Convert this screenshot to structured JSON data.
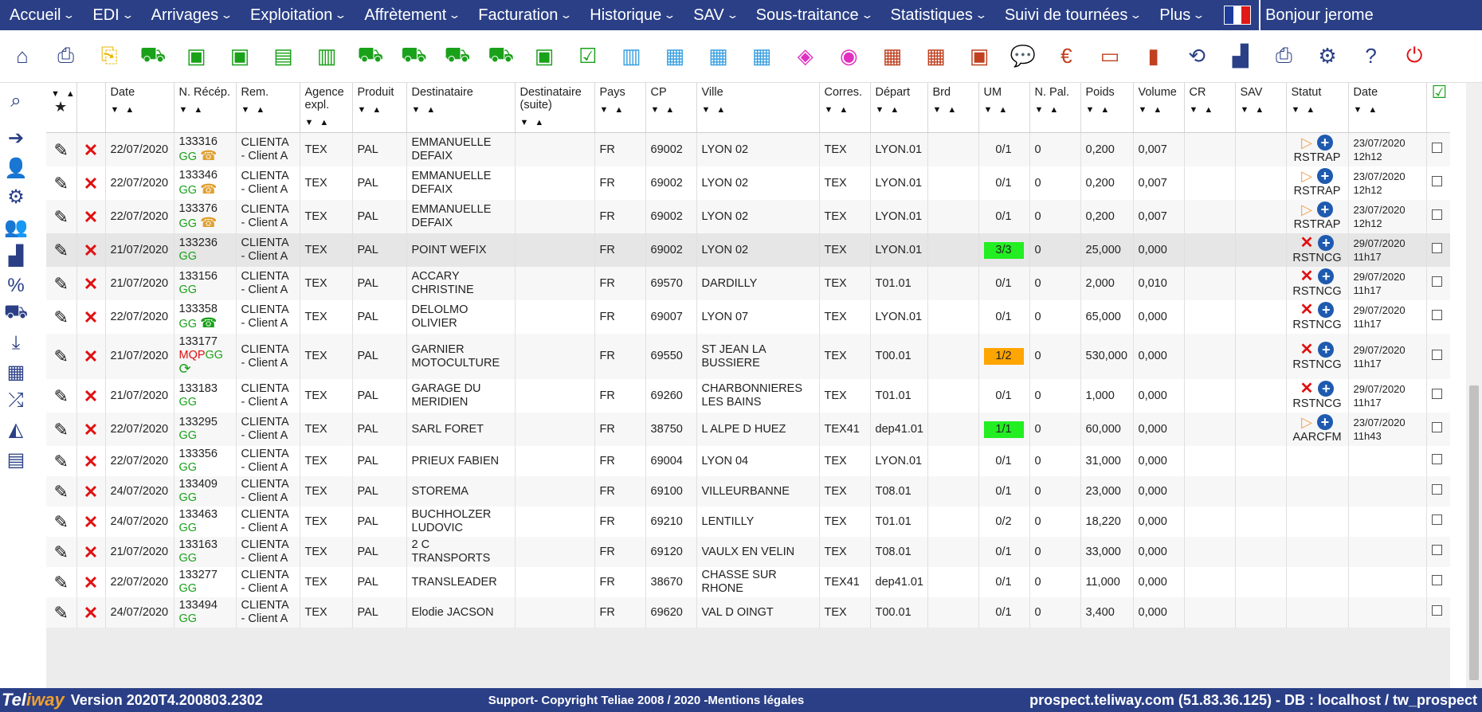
{
  "nav": {
    "items": [
      "Accueil",
      "EDI",
      "Arrivages",
      "Exploitation",
      "Affrètement",
      "Facturation",
      "Historique",
      "SAV",
      "Sous-traitance",
      "Statistiques",
      "Suivi de tournées",
      "Plus"
    ],
    "greeting": "Bonjour jerome"
  },
  "colors": {
    "navy": "#2a3f86",
    "accent_green": "#1aa11a",
    "delete_red": "#e01010"
  },
  "toolbar_icons": [
    "home-icon",
    "printer-icon",
    "edi-file-icon",
    "truck-icon",
    "box-x-icon",
    "box-plus-icon",
    "boxes-icon",
    "barcode-icon",
    "trucks-icon",
    "trucks-grid-icon",
    "trucks-swap-icon",
    "truck-fast-icon",
    "box-info-icon",
    "checkbox-icon",
    "barcode-info-icon",
    "cubes-icon",
    "cubes-swap-icon",
    "calendar-info-icon",
    "database-icon",
    "coins-icon",
    "calendar-icon",
    "calendar-edit-icon",
    "box-question-icon",
    "chat-icon",
    "euro-icon",
    "monitor-arrow-icon",
    "book-icon",
    "history-icon",
    "chart-icon",
    "print-icon",
    "gear-icon",
    "help-icon",
    "power-icon"
  ],
  "sidebar_icons": [
    "search-icon",
    "arrow-right-circle-icon",
    "user-icon",
    "gears-icon",
    "users-icon",
    "factory-icon",
    "percent-icon",
    "truck-icon",
    "download-icon",
    "table-icon",
    "shuffle-icon",
    "area-chart-icon",
    "document-icon"
  ],
  "columns": [
    "Date",
    "N. Récép.",
    "Rem.",
    "Agence expl.",
    "Produit",
    "Destinataire",
    "Destinataire (suite)",
    "Pays",
    "CP",
    "Ville",
    "Corres.",
    "Départ",
    "Brd",
    "UM",
    "N. Pal.",
    "Poids",
    "Volume",
    "CR",
    "SAV",
    "Statut",
    "Date"
  ],
  "rows": [
    {
      "date": "22/07/2020",
      "recep": "133316",
      "tags": "GG",
      "phone": "orange",
      "rem": "CLIENTA - Client A",
      "agence": "TEX",
      "produit": "PAL",
      "dest": "EMMANUELLE DEFAIX",
      "pays": "FR",
      "cp": "69002",
      "ville": "LYON 02",
      "corres": "TEX",
      "depart": "LYON.01",
      "um": "0/1",
      "um_style": "none",
      "npal": "0",
      "poids": "0,200",
      "volume": "0,007",
      "statut_icon": "play",
      "statut": "RSTRAP",
      "date2": "23/07/2020 12h12"
    },
    {
      "date": "22/07/2020",
      "recep": "133346",
      "tags": "GG",
      "phone": "orange",
      "rem": "CLIENTA - Client A",
      "agence": "TEX",
      "produit": "PAL",
      "dest": "EMMANUELLE DEFAIX",
      "pays": "FR",
      "cp": "69002",
      "ville": "LYON 02",
      "corres": "TEX",
      "depart": "LYON.01",
      "um": "0/1",
      "um_style": "none",
      "npal": "0",
      "poids": "0,200",
      "volume": "0,007",
      "statut_icon": "play",
      "statut": "RSTRAP",
      "date2": "23/07/2020 12h12"
    },
    {
      "date": "22/07/2020",
      "recep": "133376",
      "tags": "GG",
      "phone": "orange",
      "rem": "CLIENTA - Client A",
      "agence": "TEX",
      "produit": "PAL",
      "dest": "EMMANUELLE DEFAIX",
      "pays": "FR",
      "cp": "69002",
      "ville": "LYON 02",
      "corres": "TEX",
      "depart": "LYON.01",
      "um": "0/1",
      "um_style": "none",
      "npal": "0",
      "poids": "0,200",
      "volume": "0,007",
      "statut_icon": "play",
      "statut": "RSTRAP",
      "date2": "23/07/2020 12h12"
    },
    {
      "date": "21/07/2020",
      "recep": "133236",
      "tags": "GG",
      "phone": "",
      "rem": "CLIENTA - Client A",
      "agence": "TEX",
      "produit": "PAL",
      "dest": "POINT WEFIX",
      "pays": "FR",
      "cp": "69002",
      "ville": "LYON 02",
      "corres": "TEX",
      "depart": "LYON.01",
      "um": "3/3",
      "um_style": "green",
      "npal": "0",
      "poids": "25,000",
      "volume": "0,000",
      "statut_icon": "x",
      "statut": "RSTNCG",
      "date2": "29/07/2020 11h17",
      "hl": true
    },
    {
      "date": "21/07/2020",
      "recep": "133156",
      "tags": "GG",
      "phone": "",
      "rem": "CLIENTA - Client A",
      "agence": "TEX",
      "produit": "PAL",
      "dest": "ACCARY CHRISTINE",
      "pays": "FR",
      "cp": "69570",
      "ville": "DARDILLY",
      "corres": "TEX",
      "depart": "T01.01",
      "um": "0/1",
      "um_style": "none",
      "npal": "0",
      "poids": "2,000",
      "volume": "0,010",
      "statut_icon": "x",
      "statut": "RSTNCG",
      "date2": "29/07/2020 11h17"
    },
    {
      "date": "22/07/2020",
      "recep": "133358",
      "tags": "GG",
      "phone": "green",
      "rem": "CLIENTA - Client A",
      "agence": "TEX",
      "produit": "PAL",
      "dest": "DELOLMO OLIVIER",
      "pays": "FR",
      "cp": "69007",
      "ville": "LYON 07",
      "corres": "TEX",
      "depart": "LYON.01",
      "um": "0/1",
      "um_style": "none",
      "npal": "0",
      "poids": "65,000",
      "volume": "0,000",
      "statut_icon": "x",
      "statut": "RSTNCG",
      "date2": "29/07/2020 11h17"
    },
    {
      "date": "21/07/2020",
      "recep": "133177",
      "tags": "MQPGG",
      "phone": "",
      "rem": "CLIENTA - Client A",
      "agence": "TEX",
      "produit": "PAL",
      "dest": "GARNIER MOTOCULTURE",
      "pays": "FR",
      "cp": "69550",
      "ville": "ST JEAN LA BUSSIERE",
      "corres": "TEX",
      "depart": "T00.01",
      "um": "1/2",
      "um_style": "orange",
      "npal": "0",
      "poids": "530,000",
      "volume": "0,000",
      "statut_icon": "x",
      "statut": "RSTNCG",
      "date2": "29/07/2020 11h17",
      "swap": true
    },
    {
      "date": "21/07/2020",
      "recep": "133183",
      "tags": "GG",
      "phone": "",
      "rem": "CLIENTA - Client A",
      "agence": "TEX",
      "produit": "PAL",
      "dest": "GARAGE DU MERIDIEN",
      "pays": "FR",
      "cp": "69260",
      "ville": "CHARBONNIERES LES BAINS",
      "corres": "TEX",
      "depart": "T01.01",
      "um": "0/1",
      "um_style": "none",
      "npal": "0",
      "poids": "1,000",
      "volume": "0,000",
      "statut_icon": "x",
      "statut": "RSTNCG",
      "date2": "29/07/2020 11h17"
    },
    {
      "date": "22/07/2020",
      "recep": "133295",
      "tags": "GG",
      "phone": "",
      "rem": "CLIENTA - Client A",
      "agence": "TEX",
      "produit": "PAL",
      "dest": "SARL FORET",
      "pays": "FR",
      "cp": "38750",
      "ville": "L ALPE D HUEZ",
      "corres": "TEX41",
      "depart": "dep41.01",
      "um": "1/1",
      "um_style": "green",
      "npal": "0",
      "poids": "60,000",
      "volume": "0,000",
      "statut_icon": "play",
      "statut": "AARCFM",
      "date2": "23/07/2020 11h43"
    },
    {
      "date": "22/07/2020",
      "recep": "133356",
      "tags": "GG",
      "phone": "",
      "rem": "CLIENTA - Client A",
      "agence": "TEX",
      "produit": "PAL",
      "dest": "PRIEUX FABIEN",
      "pays": "FR",
      "cp": "69004",
      "ville": "LYON 04",
      "corres": "TEX",
      "depart": "LYON.01",
      "um": "0/1",
      "um_style": "none",
      "npal": "0",
      "poids": "31,000",
      "volume": "0,000",
      "statut_icon": "",
      "statut": "",
      "date2": ""
    },
    {
      "date": "24/07/2020",
      "recep": "133409",
      "tags": "GG",
      "phone": "",
      "rem": "CLIENTA - Client A",
      "agence": "TEX",
      "produit": "PAL",
      "dest": "STOREMA",
      "pays": "FR",
      "cp": "69100",
      "ville": "VILLEURBANNE",
      "corres": "TEX",
      "depart": "T08.01",
      "um": "0/1",
      "um_style": "none",
      "npal": "0",
      "poids": "23,000",
      "volume": "0,000",
      "statut_icon": "",
      "statut": "",
      "date2": ""
    },
    {
      "date": "24/07/2020",
      "recep": "133463",
      "tags": "GG",
      "phone": "",
      "rem": "CLIENTA - Client A",
      "agence": "TEX",
      "produit": "PAL",
      "dest": "BUCHHOLZER LUDOVIC",
      "pays": "FR",
      "cp": "69210",
      "ville": "LENTILLY",
      "corres": "TEX",
      "depart": "T01.01",
      "um": "0/2",
      "um_style": "none",
      "npal": "0",
      "poids": "18,220",
      "volume": "0,000",
      "statut_icon": "",
      "statut": "",
      "date2": ""
    },
    {
      "date": "21/07/2020",
      "recep": "133163",
      "tags": "GG",
      "phone": "",
      "rem": "CLIENTA - Client A",
      "agence": "TEX",
      "produit": "PAL",
      "dest": "2 C TRANSPORTS",
      "pays": "FR",
      "cp": "69120",
      "ville": "VAULX EN VELIN",
      "corres": "TEX",
      "depart": "T08.01",
      "um": "0/1",
      "um_style": "none",
      "npal": "0",
      "poids": "33,000",
      "volume": "0,000",
      "statut_icon": "",
      "statut": "",
      "date2": ""
    },
    {
      "date": "22/07/2020",
      "recep": "133277",
      "tags": "GG",
      "phone": "",
      "rem": "CLIENTA - Client A",
      "agence": "TEX",
      "produit": "PAL",
      "dest": "TRANSLEADER",
      "pays": "FR",
      "cp": "38670",
      "ville": "CHASSE SUR RHONE",
      "corres": "TEX41",
      "depart": "dep41.01",
      "um": "0/1",
      "um_style": "none",
      "npal": "0",
      "poids": "11,000",
      "volume": "0,000",
      "statut_icon": "",
      "statut": "",
      "date2": ""
    },
    {
      "date": "24/07/2020",
      "recep": "133494",
      "tags": "GG",
      "phone": "",
      "rem": "CLIENTA - Client A",
      "agence": "TEX",
      "produit": "PAL",
      "dest": "Elodie JACSON",
      "pays": "FR",
      "cp": "69620",
      "ville": "VAL D OINGT",
      "corres": "TEX",
      "depart": "T00.01",
      "um": "0/1",
      "um_style": "none",
      "npal": "0",
      "poids": "3,400",
      "volume": "0,000",
      "statut_icon": "",
      "statut": "",
      "date2": ""
    }
  ],
  "footer": {
    "logo_tel": "Tel",
    "logo_way": "iway",
    "version": "Version 2020T4.200803.2302",
    "support": "Support",
    "copyright": "- Copyright Teliae 2008 / 2020 -",
    "legal": "Mentions légales",
    "server": "prospect.teliway.com (51.83.36.125) - DB : localhost / tw_prospect"
  }
}
